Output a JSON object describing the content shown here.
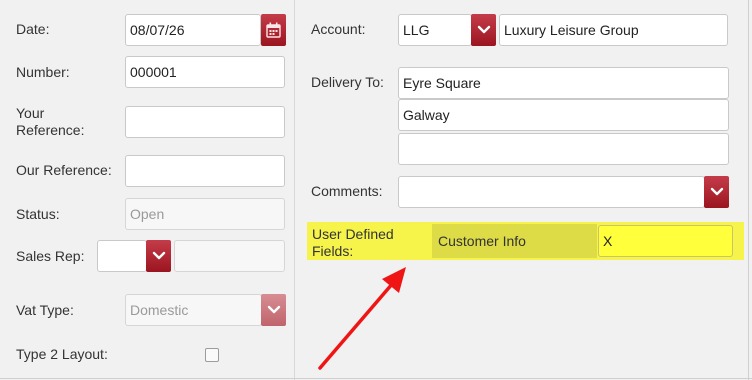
{
  "left": {
    "date_label": "Date:",
    "date_value": "08/07/26",
    "number_label": "Number:",
    "number_value": "000001",
    "your_ref_label_line1": "Your",
    "your_ref_label_line2": "Reference:",
    "your_ref_value": "",
    "our_ref_label": "Our Reference:",
    "our_ref_value": "",
    "status_label": "Status:",
    "status_value": "Open",
    "sales_rep_label": "Sales Rep:",
    "sales_rep_code": "",
    "sales_rep_name": "",
    "vat_type_label": "Vat Type:",
    "vat_type_value": "Domestic",
    "type2_label": "Type 2 Layout:",
    "type2_checked": false
  },
  "right": {
    "account_label": "Account:",
    "account_code": "LLG",
    "account_name": "Luxury Leisure Group",
    "delivery_label": "Delivery To:",
    "delivery_line1": "Eyre Square",
    "delivery_line2": "Galway",
    "delivery_line3": "",
    "comments_label": "Comments:",
    "comments_value": "",
    "udf_label_line1": "User Defined",
    "udf_label_line2": "Fields:",
    "udf_field_name": "Customer Info",
    "udf_field_value": "X"
  },
  "colors": {
    "highlight": "#f6f44a",
    "accent_red": "#b02230",
    "annotation_arrow": "#f01515"
  },
  "icons": [
    "calendar-icon",
    "chevron-down-icon",
    "checkbox",
    "annotation-arrow"
  ]
}
